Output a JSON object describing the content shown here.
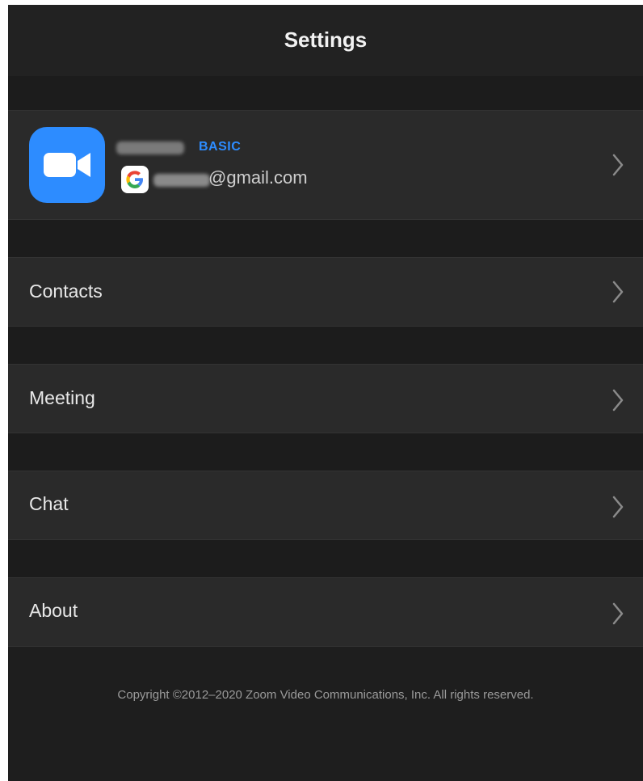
{
  "header": {
    "title": "Settings"
  },
  "profile": {
    "avatar_icon": "zoom-video-camera-icon",
    "plan": "BASIC",
    "account_icon": "google-g-icon",
    "email_domain": "@gmail.com"
  },
  "menu": {
    "items": [
      {
        "label": "Contacts"
      },
      {
        "label": "Meeting"
      },
      {
        "label": "Chat"
      },
      {
        "label": "About"
      }
    ]
  },
  "footer": {
    "copyright": "Copyright ©2012–2020 Zoom Video Communications, Inc. All rights reserved."
  },
  "colors": {
    "background": "#1e1e1e",
    "row": "#2a2a2a",
    "accent": "#2d8cff"
  }
}
